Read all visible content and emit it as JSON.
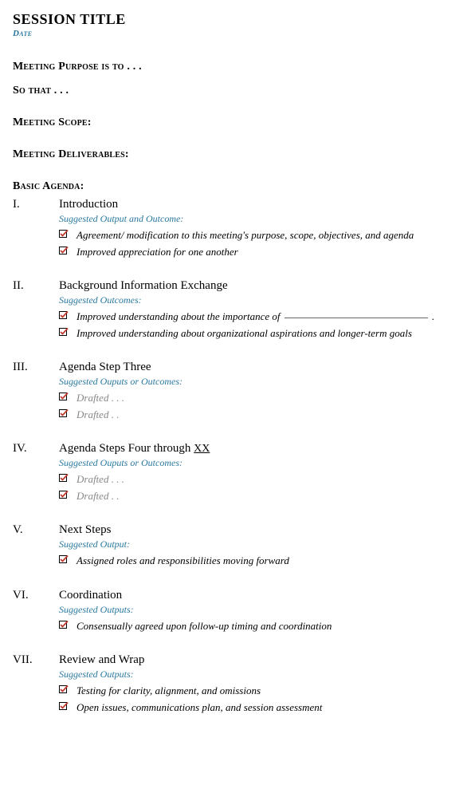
{
  "title": "SESSION TITLE",
  "date": "Date",
  "headings": {
    "purpose": "Meeting Purpose is to . . .",
    "sothat": "So that . . .",
    "scope": "Meeting Scope:",
    "deliverables": "Meeting Deliverables:",
    "agenda": "Basic Agenda:"
  },
  "agenda": [
    {
      "num": "I.",
      "title": "Introduction",
      "suggested": "Suggested Output and Outcome:",
      "bullets": [
        {
          "text": "Agreement/ modification to this meeting's purpose, scope, objectives, and agenda",
          "muted": false
        },
        {
          "text": "Improved appreciation for one another",
          "muted": false
        }
      ]
    },
    {
      "num": "II.",
      "title": "Background Information Exchange",
      "suggested": "Suggested Outcomes:",
      "bullets": [
        {
          "text_pre": "Improved understanding about the importance of",
          "fill": true,
          "text_post": " .",
          "muted": false
        },
        {
          "text": "Improved understanding about organizational aspirations and longer-term goals",
          "muted": false
        }
      ]
    },
    {
      "num": "III.",
      "title": "Agenda Step Three",
      "suggested": "Suggested Ouputs or Outcomes:",
      "bullets": [
        {
          "text": "Drafted . . .",
          "muted": true
        },
        {
          "text": "Drafted . .",
          "muted": true
        }
      ]
    },
    {
      "num": "IV.",
      "title_pre": "Agenda Steps Four through ",
      "title_xx": "XX",
      "suggested": "Suggested Ouputs or Outcomes:",
      "bullets": [
        {
          "text": "Drafted . . .",
          "muted": true
        },
        {
          "text": "Drafted . .",
          "muted": true
        }
      ]
    },
    {
      "num": "V.",
      "title": "Next Steps",
      "suggested": "Suggested Output:",
      "bullets": [
        {
          "text": "Assigned roles and responsibilities moving forward",
          "muted": false
        }
      ]
    },
    {
      "num": "VI.",
      "title": "Coordination",
      "suggested": "Suggested Outputs:",
      "bullets": [
        {
          "text": "Consensually agreed upon follow-up timing and coordination",
          "muted": false
        }
      ]
    },
    {
      "num": "VII.",
      "title": "Review and Wrap",
      "suggested": "Suggested Outputs:",
      "bullets": [
        {
          "text": "Testing for clarity, alignment, and omissions",
          "muted": false
        },
        {
          "text": "Open issues, communications plan, and session assessment",
          "muted": false
        }
      ]
    }
  ]
}
